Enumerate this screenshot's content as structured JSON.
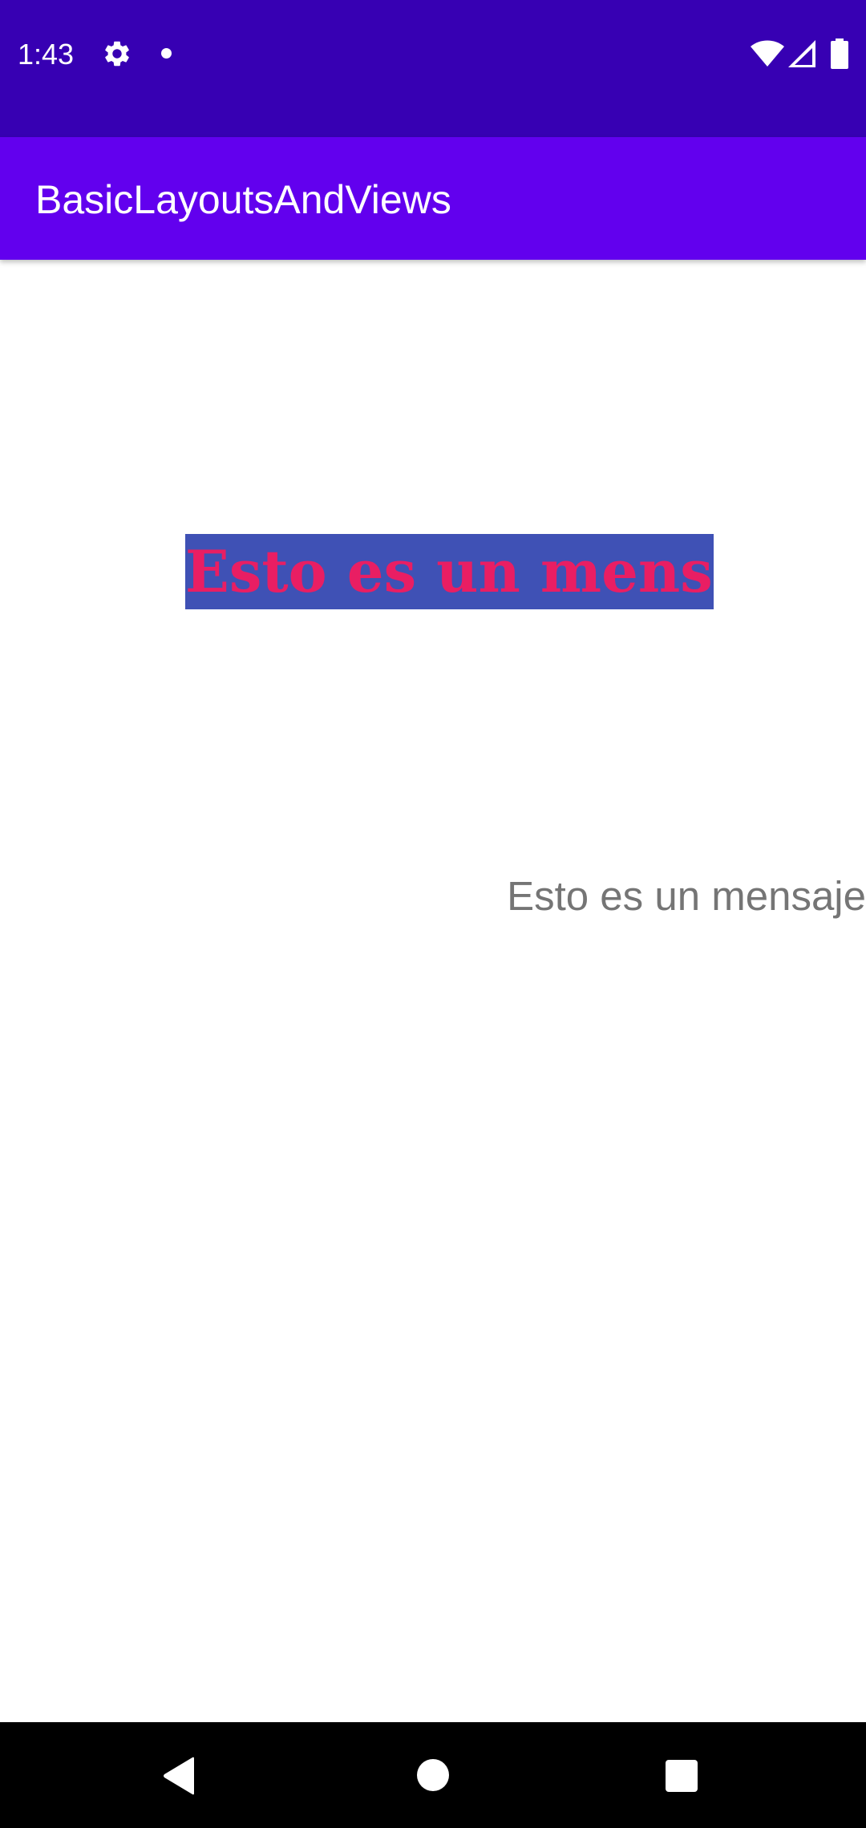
{
  "status_bar": {
    "time": "1:43",
    "icons": [
      "gear-icon",
      "notification-dot-icon",
      "wifi-icon",
      "cell-signal-icon",
      "battery-icon"
    ],
    "background_color": "#3700b3"
  },
  "app_bar": {
    "title": "BasicLayoutsAndViews",
    "background_color": "#6200ee"
  },
  "content": {
    "styled_message": {
      "text": "Esto es un mensaje",
      "text_color": "#e91e63",
      "background_color": "#3f51b5"
    },
    "plain_message": {
      "text": "Esto es un mensaje",
      "text_color": "#757575"
    }
  },
  "nav_bar": {
    "buttons": [
      "back-icon",
      "home-icon",
      "recents-icon"
    ]
  }
}
